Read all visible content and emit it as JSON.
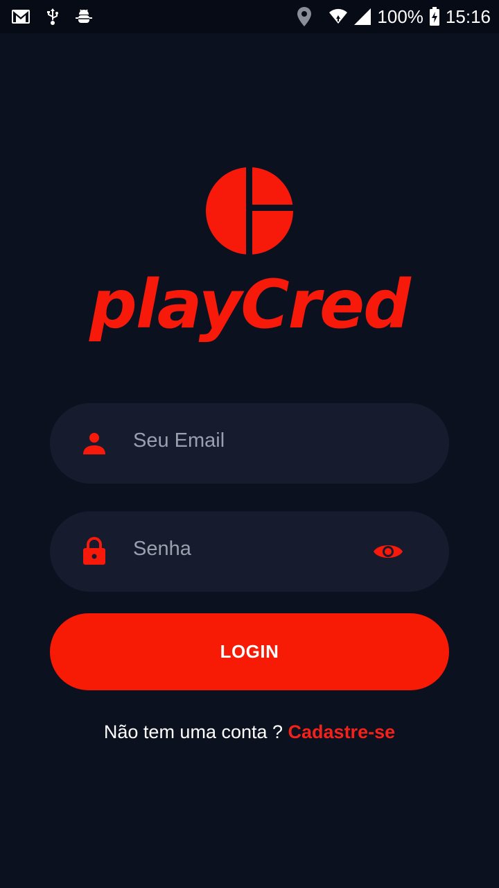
{
  "status_bar": {
    "battery": "100%",
    "time": "15:16",
    "icons": [
      "gmail-icon",
      "usb-icon",
      "android-debug-icon",
      "location-icon",
      "wifi-icon",
      "signal-icon",
      "battery-charging-icon"
    ]
  },
  "brand": {
    "name": "playCred",
    "color": "#f71a0a"
  },
  "form": {
    "email_placeholder": "Seu Email",
    "password_placeholder": "Senha",
    "login_label": "LOGIN"
  },
  "signup": {
    "prompt": "Não tem uma conta ? ",
    "link": "Cadastre-se"
  },
  "colors": {
    "background": "#0c1120",
    "field": "#161b2e",
    "accent": "#f71a04"
  }
}
